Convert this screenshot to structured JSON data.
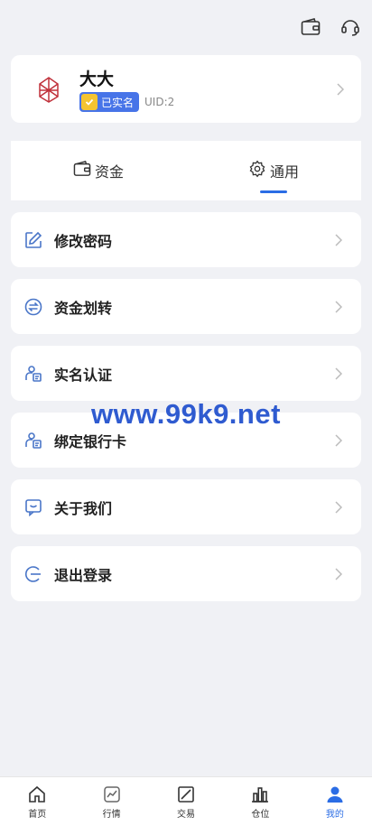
{
  "profile": {
    "name": "大大",
    "verified_label": "已实名",
    "uid": "UID:2"
  },
  "tabs": [
    {
      "label": "资金",
      "icon": "wallet-icon"
    },
    {
      "label": "通用",
      "icon": "gear-icon",
      "active": true
    }
  ],
  "menu": [
    {
      "label": "修改密码",
      "icon": "edit-icon"
    },
    {
      "label": "资金划转",
      "icon": "transfer-icon"
    },
    {
      "label": "实名认证",
      "icon": "id-badge-icon"
    },
    {
      "label": "绑定银行卡",
      "icon": "bank-card-icon"
    },
    {
      "label": "关于我们",
      "icon": "chat-bubble-icon"
    },
    {
      "label": "退出登录",
      "icon": "logout-icon"
    }
  ],
  "watermark": "www.99k9.net",
  "bottom_nav": [
    {
      "label": "首页",
      "icon": "home-icon"
    },
    {
      "label": "行情",
      "icon": "chart-icon"
    },
    {
      "label": "交易",
      "icon": "trade-icon"
    },
    {
      "label": "仓位",
      "icon": "bar-chart-icon"
    },
    {
      "label": "我的",
      "icon": "user-icon",
      "active": true
    }
  ],
  "colors": {
    "accent": "#2b6de5",
    "badge": "#4774e8",
    "background": "#f0f1f5",
    "icon_blue": "#4a76c8"
  }
}
